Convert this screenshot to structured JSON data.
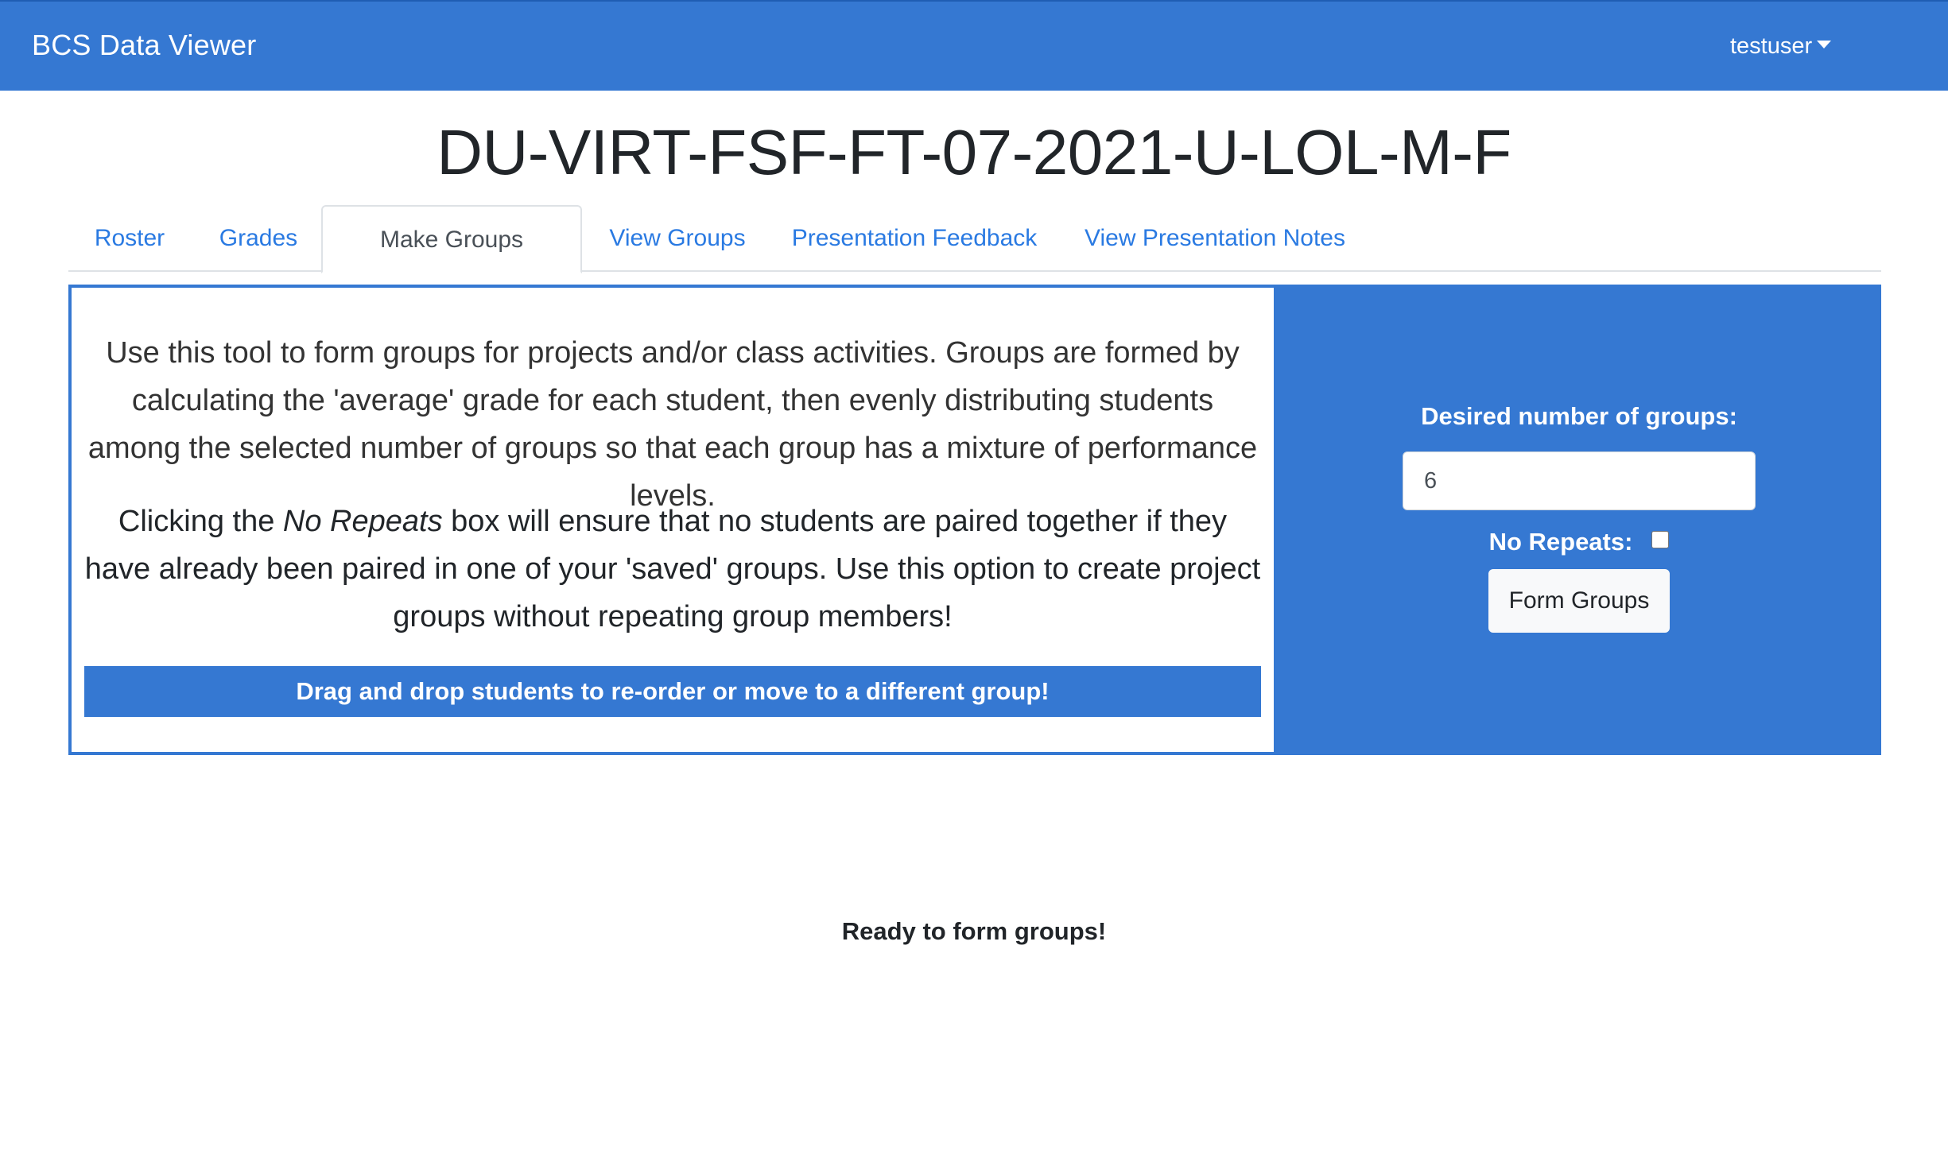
{
  "navbar": {
    "brand": "BCS Data Viewer",
    "user": "testuser",
    "color": "#3578d2"
  },
  "page": {
    "title": "DU-VIRT-FSF-FT-07-2021-U-LOL-M-F"
  },
  "tabs": [
    {
      "label": "Roster",
      "active": false
    },
    {
      "label": "Grades",
      "active": false
    },
    {
      "label": "Make Groups",
      "active": true
    },
    {
      "label": "View Groups",
      "active": false
    },
    {
      "label": "Presentation Feedback",
      "active": false
    },
    {
      "label": "View Presentation Notes",
      "active": false
    }
  ],
  "info": {
    "paragraph1": "Use this tool to form groups for projects and/or class activities. Groups are formed by calculating the 'average' grade for each student, then evenly distributing students among the selected number of groups so that each group has a mixture of performance levels.",
    "paragraph2_before": "Clicking the ",
    "paragraph2_emphasis": "No Repeats",
    "paragraph2_after": " box will ensure that no students are paired together if they have already been paired in one of your 'saved' groups. Use this option to create project groups without repeating group members!",
    "drag_hint": "Drag and drop students to re-order or move to a different group!"
  },
  "controls": {
    "groups_label": "Desired number of groups:",
    "groups_value": "6",
    "no_repeats_label": "No Repeats:",
    "no_repeats_checked": false,
    "form_button": "Form Groups"
  },
  "status": "Ready to form groups!"
}
